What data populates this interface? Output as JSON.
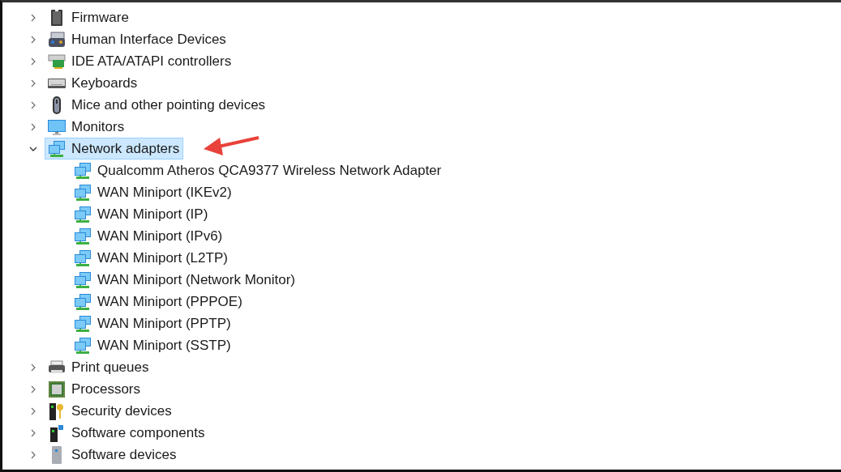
{
  "tree": [
    {
      "label": "Firmware",
      "kind": "chip",
      "expanded": false,
      "selected": false
    },
    {
      "label": "Human Interface Devices",
      "kind": "hid",
      "expanded": false,
      "selected": false
    },
    {
      "label": "IDE ATA/ATAPI controllers",
      "kind": "ide",
      "expanded": false,
      "selected": false
    },
    {
      "label": "Keyboards",
      "kind": "keyboard",
      "expanded": false,
      "selected": false
    },
    {
      "label": "Mice and other pointing devices",
      "kind": "mouse",
      "expanded": false,
      "selected": false
    },
    {
      "label": "Monitors",
      "kind": "monitor",
      "expanded": false,
      "selected": false
    },
    {
      "label": "Network adapters",
      "kind": "network",
      "expanded": true,
      "selected": true,
      "children": [
        {
          "label": "Qualcomm Atheros QCA9377 Wireless Network Adapter",
          "kind": "network"
        },
        {
          "label": "WAN Miniport (IKEv2)",
          "kind": "network"
        },
        {
          "label": "WAN Miniport (IP)",
          "kind": "network"
        },
        {
          "label": "WAN Miniport (IPv6)",
          "kind": "network"
        },
        {
          "label": "WAN Miniport (L2TP)",
          "kind": "network"
        },
        {
          "label": "WAN Miniport (Network Monitor)",
          "kind": "network"
        },
        {
          "label": "WAN Miniport (PPPOE)",
          "kind": "network"
        },
        {
          "label": "WAN Miniport (PPTP)",
          "kind": "network"
        },
        {
          "label": "WAN Miniport (SSTP)",
          "kind": "network"
        }
      ]
    },
    {
      "label": "Print queues",
      "kind": "printer",
      "expanded": false,
      "selected": false
    },
    {
      "label": "Processors",
      "kind": "processor",
      "expanded": false,
      "selected": false
    },
    {
      "label": "Security devices",
      "kind": "security",
      "expanded": false,
      "selected": false
    },
    {
      "label": "Software components",
      "kind": "component",
      "expanded": false,
      "selected": false
    },
    {
      "label": "Software devices",
      "kind": "softdevice",
      "expanded": false,
      "selected": false
    }
  ]
}
